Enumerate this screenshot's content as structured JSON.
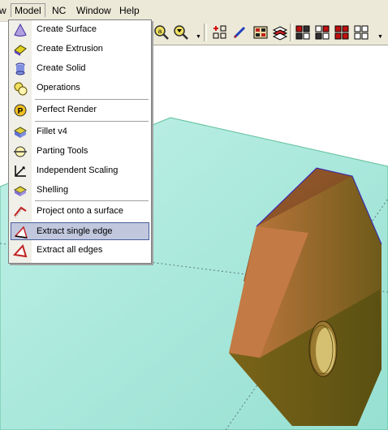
{
  "menubar": {
    "items": [
      {
        "label": "w"
      },
      {
        "label": "Model"
      },
      {
        "label": "NC"
      },
      {
        "label": "Window"
      },
      {
        "label": "Help"
      }
    ]
  },
  "toolbar": {
    "icons": [
      "zoom-icon",
      "zoom-window-icon",
      "add-grid-icon",
      "pen-icon",
      "render-modes-icon",
      "layers-icon",
      "view-grid-icon",
      "view-layout-icon",
      "view-quad-icon",
      "view-split-icon"
    ]
  },
  "model_menu": {
    "items": [
      {
        "label": "Create Surface",
        "icon": "surface-icon"
      },
      {
        "label": "Create Extrusion",
        "icon": "extrusion-icon"
      },
      {
        "label": "Create Solid",
        "icon": "solid-cylinder-icon"
      },
      {
        "label": "Operations",
        "icon": "operations-icon"
      },
      {
        "label": "Perfect Render",
        "icon": "perfect-render-icon"
      },
      {
        "label": "Fillet v4",
        "icon": "fillet-icon"
      },
      {
        "label": "Parting Tools",
        "icon": "parting-tools-icon"
      },
      {
        "label": "Independent Scaling",
        "icon": "scaling-icon"
      },
      {
        "label": "Shelling",
        "icon": "shelling-icon"
      },
      {
        "label": "Project onto a surface",
        "icon": "project-icon"
      },
      {
        "label": "Extract single edge",
        "icon": "extract-edge-icon",
        "highlighted": true
      },
      {
        "label": "Extract all edges",
        "icon": "extract-all-edges-icon"
      }
    ]
  },
  "colors": {
    "menu_highlight": "#c1c8de",
    "ground_plane": "#a8e6dc",
    "part_face_front": "#c8743c",
    "part_face_top": "#8a5030"
  }
}
